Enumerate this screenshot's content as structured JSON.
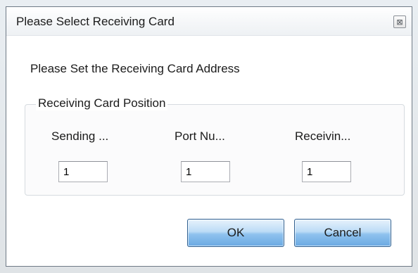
{
  "window": {
    "title": "Please Select Receiving Card",
    "close_glyph": "⊠"
  },
  "main": {
    "heading": "Please Set the Receiving Card Address",
    "group": {
      "title": "Receiving Card Position",
      "columns": [
        {
          "label": "Sending ...",
          "value": "1"
        },
        {
          "label": "Port Nu...",
          "value": "1"
        },
        {
          "label": "Receivin...",
          "value": "1"
        }
      ]
    }
  },
  "buttons": {
    "ok_label": "OK",
    "cancel_label": "Cancel"
  },
  "colors": {
    "button_accent": "#6aa9e2",
    "dialog_border": "#6f7a86"
  },
  "icons": {
    "close": "close-icon"
  }
}
